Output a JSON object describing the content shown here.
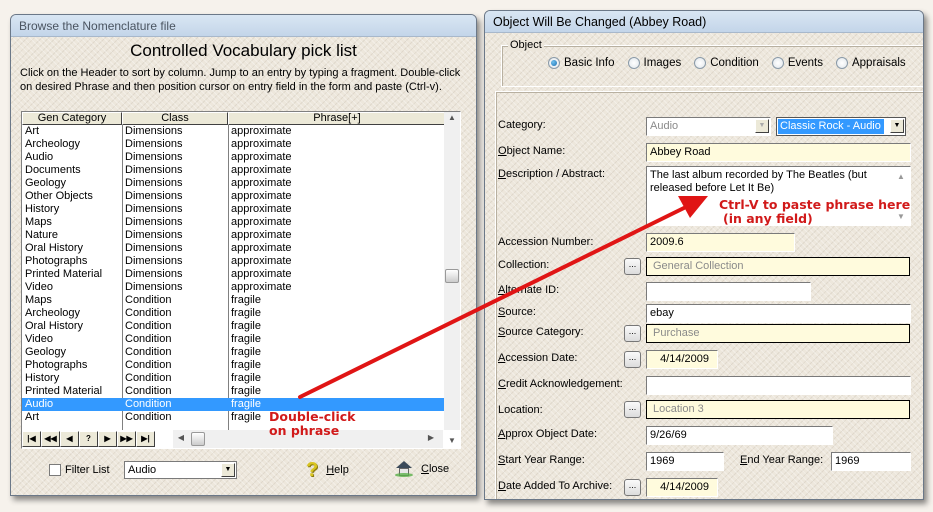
{
  "left_window": {
    "title": "Browse the Nomenclature file",
    "heading": "Controlled Vocabulary pick list",
    "instructions": "Click on the Header to sort by column. Jump to an entry by typing a fragment. Double-click on desired Phrase and then position cursor on entry field in the form and paste (Ctrl-v).",
    "columns": [
      "Gen Category",
      "Class",
      "Phrase[+]"
    ],
    "rows": [
      [
        "Art",
        "Dimensions",
        "approximate"
      ],
      [
        "Archeology",
        "Dimensions",
        "approximate"
      ],
      [
        "Audio",
        "Dimensions",
        "approximate"
      ],
      [
        "Documents",
        "Dimensions",
        "approximate"
      ],
      [
        "Geology",
        "Dimensions",
        "approximate"
      ],
      [
        "Other Objects",
        "Dimensions",
        "approximate"
      ],
      [
        "History",
        "Dimensions",
        "approximate"
      ],
      [
        "Maps",
        "Dimensions",
        "approximate"
      ],
      [
        "Nature",
        "Dimensions",
        "approximate"
      ],
      [
        "Oral History",
        "Dimensions",
        "approximate"
      ],
      [
        "Photographs",
        "Dimensions",
        "approximate"
      ],
      [
        "Printed Material",
        "Dimensions",
        "approximate"
      ],
      [
        "Video",
        "Dimensions",
        "approximate"
      ],
      [
        "Maps",
        "Condition",
        "fragile"
      ],
      [
        "Archeology",
        "Condition",
        "fragile"
      ],
      [
        "Oral History",
        "Condition",
        "fragile"
      ],
      [
        "Video",
        "Condition",
        "fragile"
      ],
      [
        "Geology",
        "Condition",
        "fragile"
      ],
      [
        "Photographs",
        "Condition",
        "fragile"
      ],
      [
        "History",
        "Condition",
        "fragile"
      ],
      [
        "Printed Material",
        "Condition",
        "fragile"
      ],
      [
        "Audio",
        "Condition",
        "fragile"
      ],
      [
        "Art",
        "Condition",
        "fragile"
      ]
    ],
    "selected_row_index": 21,
    "nav_buttons": [
      "first",
      "prev-page",
      "prev",
      "?",
      "next",
      "next-page",
      "last"
    ],
    "nav_glyphs": [
      "|◀",
      "◀◀",
      "◀",
      "?",
      "▶",
      "▶▶",
      "▶|"
    ],
    "filter_label": "Filter List",
    "filter_checked": false,
    "filter_value": "Audio",
    "help_label": "Help",
    "close_label": "Close",
    "annotation_line1": "Double-click",
    "annotation_line2": "on phrase"
  },
  "right_window": {
    "title": "Object Will Be Changed  (Abbey Road)",
    "group_label": "Object",
    "radios": [
      {
        "label": "Basic Info",
        "checked": true
      },
      {
        "label": "Images",
        "checked": false
      },
      {
        "label": "Condition",
        "checked": false
      },
      {
        "label": "Events",
        "checked": false
      },
      {
        "label": "Appraisals",
        "checked": false
      }
    ],
    "fields": {
      "category_label": "Category:",
      "category_value": "Audio",
      "subcategory_value": "Classic Rock - Audio",
      "object_name_label": "Object Name:",
      "object_name_value": "Abbey Road",
      "description_label": "Description / Abstract:",
      "description_value": "The last album recorded by The Beatles (but released before Let It Be)",
      "accession_number_label": "Accession Number:",
      "accession_number_value": "2009.6",
      "collection_label": "Collection:",
      "collection_value": "General Collection",
      "alternate_id_label": "Alternate ID:",
      "alternate_id_value": "",
      "source_label": "Source:",
      "source_value": "ebay",
      "source_category_label": "Source Category:",
      "source_category_value": "Purchase",
      "accession_date_label": "Accession Date:",
      "accession_date_value": "4/14/2009",
      "credit_label": "Credit Acknowledgement:",
      "credit_value": "",
      "location_label": "Location:",
      "location_value": "Location 3",
      "approx_date_label": "Approx Object Date:",
      "approx_date_value": "9/26/69",
      "start_year_label": "Start Year Range:",
      "start_year_value": "1969",
      "end_year_label": "End Year Range:",
      "end_year_value": "1969",
      "date_added_label": "Date Added To Archive:",
      "date_added_value": "4/14/2009"
    },
    "ellipsis": "...",
    "annotation_line1": "Ctrl-V to paste phrase here",
    "annotation_line2": " (in any field)"
  },
  "colors": {
    "selection": "#3399ff",
    "annotation": "#d11a1a",
    "readonly_field": "#fffbdd"
  }
}
